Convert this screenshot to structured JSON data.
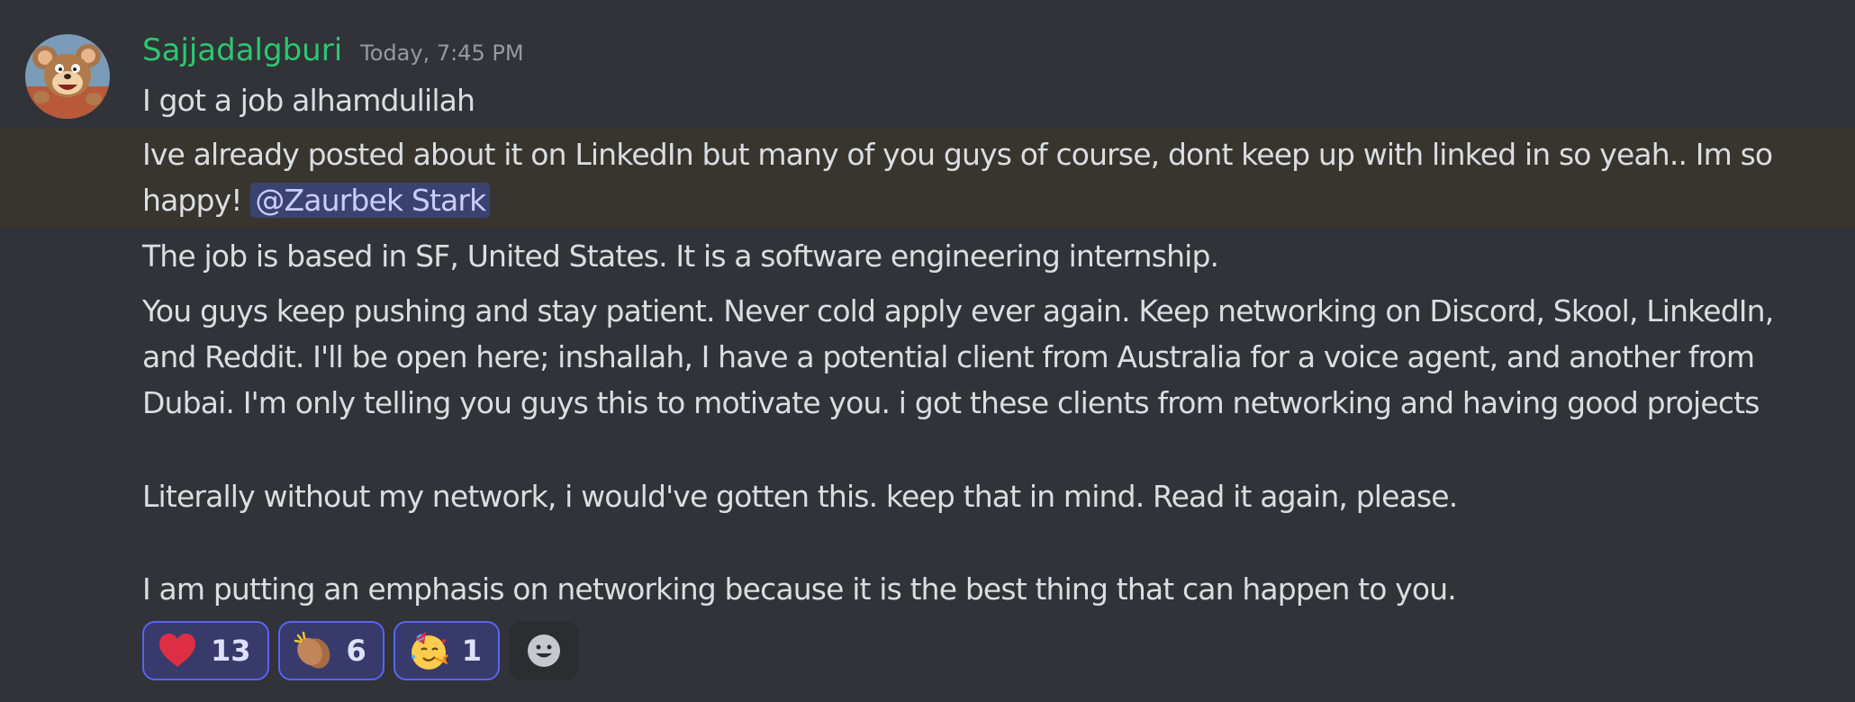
{
  "author": {
    "username": "Sajjadalgburi",
    "timestamp": "Today, 7:45 PM",
    "avatar_icon": "cartoon-mouse-avatar"
  },
  "messages": [
    {
      "text": "I got a job alhamdulilah"
    },
    {
      "text_before": "Ive already posted about it on LinkedIn but many of you guys of course, dont keep up with linked in so yeah.. Im so happy! ",
      "mention": "@Zaurbek Stark"
    },
    {
      "text": "The job is based in SF, United States. It is a software engineering internship."
    },
    {
      "text": "You guys keep pushing and stay patient. Never cold apply ever again. Keep networking on Discord, Skool, LinkedIn, and Reddit. I'll be open here; inshallah, I have a potential client from Australia for a voice agent, and another from Dubai. I'm only telling you guys this to motivate you. i got these clients from networking and having good projects"
    },
    {
      "text": "Literally without my network, i would've gotten this. keep that in mind. Read it again, please."
    },
    {
      "text": "I am putting an emphasis on networking because it is the best thing that can happen to you."
    }
  ],
  "reactions": [
    {
      "emoji": "heart-emoji",
      "count": "13"
    },
    {
      "emoji": "clapping-hands-emoji",
      "count": "6"
    },
    {
      "emoji": "partying-face-emoji",
      "count": "1"
    }
  ],
  "add_reaction_icon": "smiley-add-reaction-icon",
  "colors": {
    "background": "#313338",
    "username": "#2dc770",
    "highlight_row": "#38352e",
    "mention_bg": "#3c4270",
    "reaction_border": "#5865f2"
  }
}
